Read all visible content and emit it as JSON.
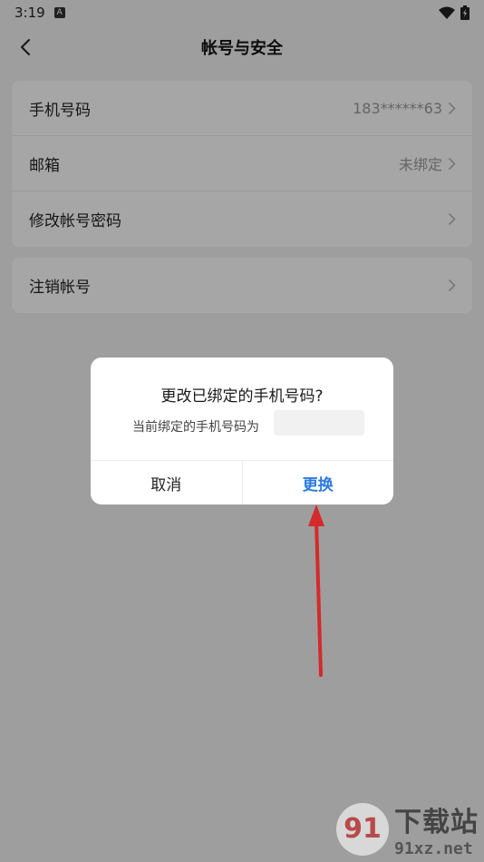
{
  "status_bar": {
    "time": "3:19",
    "notif_letter": "A"
  },
  "header": {
    "title": "帐号与安全"
  },
  "card1": {
    "rows": [
      {
        "label": "手机号码",
        "value": "183******63"
      },
      {
        "label": "邮箱",
        "value": "未绑定"
      },
      {
        "label": "修改帐号密码",
        "value": ""
      }
    ]
  },
  "card2": {
    "rows": [
      {
        "label": "注销帐号"
      }
    ]
  },
  "dialog": {
    "title": "更改已绑定的手机号码?",
    "message": "当前绑定的手机号码为",
    "cancel_label": "取消",
    "confirm_label": "更换"
  },
  "watermark": {
    "logo_glyph": "91",
    "cn_text": "下载站",
    "domain": "91xz.net"
  },
  "colors": {
    "accent": "#2a7ae2",
    "arrow": "#d42a2a"
  }
}
